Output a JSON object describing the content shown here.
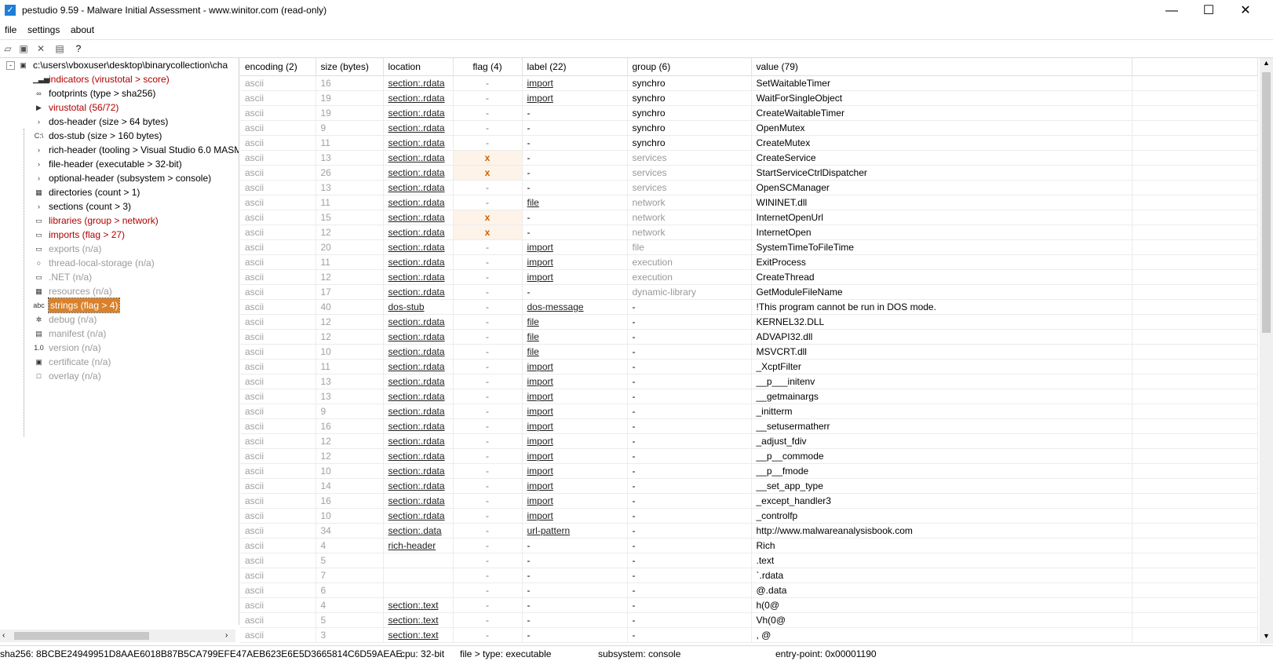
{
  "window": {
    "title": "pestudio 9.59 - Malware Initial Assessment - www.winitor.com (read-only)",
    "buttons": {
      "minimize": "—",
      "maximize": "☐",
      "close": "✕"
    }
  },
  "menu": [
    "file",
    "settings",
    "about"
  ],
  "toolbar_icons": [
    "open-icon",
    "save-icon",
    "delete-icon",
    "list-icon",
    "help-icon"
  ],
  "tree": [
    {
      "label": "c:\\users\\vboxuser\\desktop\\binarycollection\\cha",
      "icon": "▣",
      "style": "",
      "root": true
    },
    {
      "label": "indicators (virustotal > score)",
      "icon": "▁▃▅",
      "style": "red"
    },
    {
      "label": "footprints (type > sha256)",
      "icon": "∞",
      "style": ""
    },
    {
      "label": "virustotal (56/72)",
      "icon": "▶",
      "style": "red"
    },
    {
      "label": "dos-header (size > 64 bytes)",
      "icon": "›",
      "style": ""
    },
    {
      "label": "dos-stub (size > 160 bytes)",
      "icon": "C:\\",
      "style": ""
    },
    {
      "label": "rich-header (tooling > Visual Studio 6.0 MASM",
      "icon": "›",
      "style": ""
    },
    {
      "label": "file-header (executable > 32-bit)",
      "icon": "›",
      "style": ""
    },
    {
      "label": "optional-header (subsystem > console)",
      "icon": "›",
      "style": ""
    },
    {
      "label": "directories (count > 1)",
      "icon": "▦",
      "style": ""
    },
    {
      "label": "sections (count > 3)",
      "icon": "›",
      "style": ""
    },
    {
      "label": "libraries (group > network)",
      "icon": "▭",
      "style": "red"
    },
    {
      "label": "imports (flag > 27)",
      "icon": "▭",
      "style": "red"
    },
    {
      "label": "exports (n/a)",
      "icon": "▭",
      "style": "gray"
    },
    {
      "label": "thread-local-storage (n/a)",
      "icon": "○",
      "style": "gray"
    },
    {
      "label": ".NET (n/a)",
      "icon": "▭",
      "style": "gray"
    },
    {
      "label": "resources (n/a)",
      "icon": "▦",
      "style": "gray"
    },
    {
      "label": "strings (flag > 4)",
      "icon": "abc",
      "style": "sel"
    },
    {
      "label": "debug (n/a)",
      "icon": "✲",
      "style": "gray"
    },
    {
      "label": "manifest (n/a)",
      "icon": "▤",
      "style": "gray"
    },
    {
      "label": "version (n/a)",
      "icon": "1.0",
      "style": "gray"
    },
    {
      "label": "certificate (n/a)",
      "icon": "▣",
      "style": "gray"
    },
    {
      "label": "overlay (n/a)",
      "icon": "□",
      "style": "gray"
    }
  ],
  "columns": [
    "encoding (2)",
    "size (bytes)",
    "location",
    "flag (4)",
    "label (22)",
    "group (6)",
    "value (79)"
  ],
  "rows": [
    {
      "enc": "ascii",
      "size": "16",
      "loc": "section:.rdata",
      "flag": "-",
      "label": "import",
      "group": "synchro",
      "value": "SetWaitableTimer"
    },
    {
      "enc": "ascii",
      "size": "19",
      "loc": "section:.rdata",
      "flag": "-",
      "label": "import",
      "group": "synchro",
      "value": "WaitForSingleObject"
    },
    {
      "enc": "ascii",
      "size": "19",
      "loc": "section:.rdata",
      "flag": "-",
      "label": "-",
      "group": "synchro",
      "value": "CreateWaitableTimer"
    },
    {
      "enc": "ascii",
      "size": "9",
      "loc": "section:.rdata",
      "flag": "-",
      "label": "-",
      "group": "synchro",
      "value": "OpenMutex"
    },
    {
      "enc": "ascii",
      "size": "11",
      "loc": "section:.rdata",
      "flag": "-",
      "label": "-",
      "group": "synchro",
      "value": "CreateMutex"
    },
    {
      "enc": "ascii",
      "size": "13",
      "loc": "section:.rdata",
      "flag": "x",
      "label": "-",
      "group": "services",
      "value": "CreateService"
    },
    {
      "enc": "ascii",
      "size": "26",
      "loc": "section:.rdata",
      "flag": "x",
      "label": "-",
      "group": "services",
      "value": "StartServiceCtrlDispatcher"
    },
    {
      "enc": "ascii",
      "size": "13",
      "loc": "section:.rdata",
      "flag": "-",
      "label": "-",
      "group": "services",
      "value": "OpenSCManager"
    },
    {
      "enc": "ascii",
      "size": "11",
      "loc": "section:.rdata",
      "flag": "-",
      "label": "file",
      "group": "network",
      "value": "WININET.dll"
    },
    {
      "enc": "ascii",
      "size": "15",
      "loc": "section:.rdata",
      "flag": "x",
      "label": "-",
      "group": "network",
      "value": "InternetOpenUrl"
    },
    {
      "enc": "ascii",
      "size": "12",
      "loc": "section:.rdata",
      "flag": "x",
      "label": "-",
      "group": "network",
      "value": "InternetOpen"
    },
    {
      "enc": "ascii",
      "size": "20",
      "loc": "section:.rdata",
      "flag": "-",
      "label": "import",
      "group": "file",
      "value": "SystemTimeToFileTime"
    },
    {
      "enc": "ascii",
      "size": "11",
      "loc": "section:.rdata",
      "flag": "-",
      "label": "import",
      "group": "execution",
      "value": "ExitProcess"
    },
    {
      "enc": "ascii",
      "size": "12",
      "loc": "section:.rdata",
      "flag": "-",
      "label": "import",
      "group": "execution",
      "value": "CreateThread"
    },
    {
      "enc": "ascii",
      "size": "17",
      "loc": "section:.rdata",
      "flag": "-",
      "label": "-",
      "group": "dynamic-library",
      "value": "GetModuleFileName"
    },
    {
      "enc": "ascii",
      "size": "40",
      "loc": "dos-stub",
      "flag": "-",
      "label": "dos-message",
      "group": "-",
      "value": "!This program cannot be run in DOS mode."
    },
    {
      "enc": "ascii",
      "size": "12",
      "loc": "section:.rdata",
      "flag": "-",
      "label": "file",
      "group": "-",
      "value": "KERNEL32.DLL"
    },
    {
      "enc": "ascii",
      "size": "12",
      "loc": "section:.rdata",
      "flag": "-",
      "label": "file",
      "group": "-",
      "value": "ADVAPI32.dll"
    },
    {
      "enc": "ascii",
      "size": "10",
      "loc": "section:.rdata",
      "flag": "-",
      "label": "file",
      "group": "-",
      "value": "MSVCRT.dll"
    },
    {
      "enc": "ascii",
      "size": "11",
      "loc": "section:.rdata",
      "flag": "-",
      "label": "import",
      "group": "-",
      "value": "_XcptFilter"
    },
    {
      "enc": "ascii",
      "size": "13",
      "loc": "section:.rdata",
      "flag": "-",
      "label": "import",
      "group": "-",
      "value": "__p___initenv"
    },
    {
      "enc": "ascii",
      "size": "13",
      "loc": "section:.rdata",
      "flag": "-",
      "label": "import",
      "group": "-",
      "value": "__getmainargs"
    },
    {
      "enc": "ascii",
      "size": "9",
      "loc": "section:.rdata",
      "flag": "-",
      "label": "import",
      "group": "-",
      "value": "_initterm"
    },
    {
      "enc": "ascii",
      "size": "16",
      "loc": "section:.rdata",
      "flag": "-",
      "label": "import",
      "group": "-",
      "value": "__setusermatherr"
    },
    {
      "enc": "ascii",
      "size": "12",
      "loc": "section:.rdata",
      "flag": "-",
      "label": "import",
      "group": "-",
      "value": "_adjust_fdiv"
    },
    {
      "enc": "ascii",
      "size": "12",
      "loc": "section:.rdata",
      "flag": "-",
      "label": "import",
      "group": "-",
      "value": "__p__commode"
    },
    {
      "enc": "ascii",
      "size": "10",
      "loc": "section:.rdata",
      "flag": "-",
      "label": "import",
      "group": "-",
      "value": "__p__fmode"
    },
    {
      "enc": "ascii",
      "size": "14",
      "loc": "section:.rdata",
      "flag": "-",
      "label": "import",
      "group": "-",
      "value": "__set_app_type"
    },
    {
      "enc": "ascii",
      "size": "16",
      "loc": "section:.rdata",
      "flag": "-",
      "label": "import",
      "group": "-",
      "value": "_except_handler3"
    },
    {
      "enc": "ascii",
      "size": "10",
      "loc": "section:.rdata",
      "flag": "-",
      "label": "import",
      "group": "-",
      "value": "_controlfp"
    },
    {
      "enc": "ascii",
      "size": "34",
      "loc": "section:.data",
      "flag": "-",
      "label": "url-pattern",
      "group": "-",
      "value": "http://www.malwareanalysisbook.com"
    },
    {
      "enc": "ascii",
      "size": "4",
      "loc": "rich-header",
      "flag": "-",
      "label": "-",
      "group": "-",
      "value": "Rich"
    },
    {
      "enc": "ascii",
      "size": "5",
      "loc": "",
      "flag": "-",
      "label": "-",
      "group": "-",
      "value": ".text"
    },
    {
      "enc": "ascii",
      "size": "7",
      "loc": "",
      "flag": "-",
      "label": "-",
      "group": "-",
      "value": "`.rdata"
    },
    {
      "enc": "ascii",
      "size": "6",
      "loc": "",
      "flag": "-",
      "label": "-",
      "group": "-",
      "value": "@.data"
    },
    {
      "enc": "ascii",
      "size": "4",
      "loc": "section:.text",
      "flag": "-",
      "label": "-",
      "group": "-",
      "value": "h(0@"
    },
    {
      "enc": "ascii",
      "size": "5",
      "loc": "section:.text",
      "flag": "-",
      "label": "-",
      "group": "-",
      "value": "Vh(0@"
    },
    {
      "enc": "ascii",
      "size": "3",
      "loc": "section:.text",
      "flag": "-",
      "label": "-",
      "group": "-",
      "value": ", @"
    }
  ],
  "status": {
    "sha256": "sha256: 8BCBE24949951D8AAE6018B87B5CA799EFE47AEB623E6E5D3665814C6D59AEAE",
    "cpu": "cpu: 32-bit",
    "file_type": "file > type: executable",
    "subsystem": "subsystem: console",
    "entry_point": "entry-point: 0x00001190"
  }
}
